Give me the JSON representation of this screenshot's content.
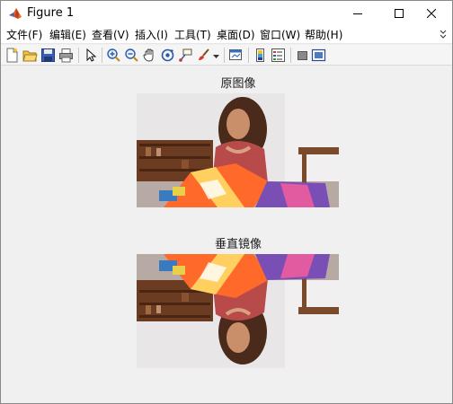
{
  "window": {
    "title": "Figure 1",
    "controls": {
      "minimize": "—",
      "maximize": "☐",
      "close": "✕"
    }
  },
  "menubar": {
    "items": [
      {
        "label": "文件(F)"
      },
      {
        "label": "编辑(E)"
      },
      {
        "label": "查看(V)"
      },
      {
        "label": "插入(I)"
      },
      {
        "label": "工具(T)"
      },
      {
        "label": "桌面(D)"
      },
      {
        "label": "窗口(W)"
      },
      {
        "label": "帮助(H)"
      }
    ]
  },
  "toolbar": {
    "icons": [
      "new-figure-icon",
      "open-file-icon",
      "save-icon",
      "print-icon",
      "edit-plot-arrow-icon",
      "zoom-in-icon",
      "zoom-out-icon",
      "pan-hand-icon",
      "rotate-3d-icon",
      "data-cursor-icon",
      "brush-icon",
      "brush-dropdown-icon",
      "link-plot-icon",
      "insert-colorbar-icon",
      "insert-legend-icon",
      "hide-plot-tools-icon",
      "show-plot-tools-icon"
    ]
  },
  "figure": {
    "top_axes_title": "原图像",
    "bottom_axes_title": "垂直镜像",
    "colors": {
      "wall": "#e9e6e6",
      "shelf_wood": "#6b3b22",
      "fabric_orange": "#ff6a2a",
      "fabric_purple": "#7a4fb5"
    }
  }
}
